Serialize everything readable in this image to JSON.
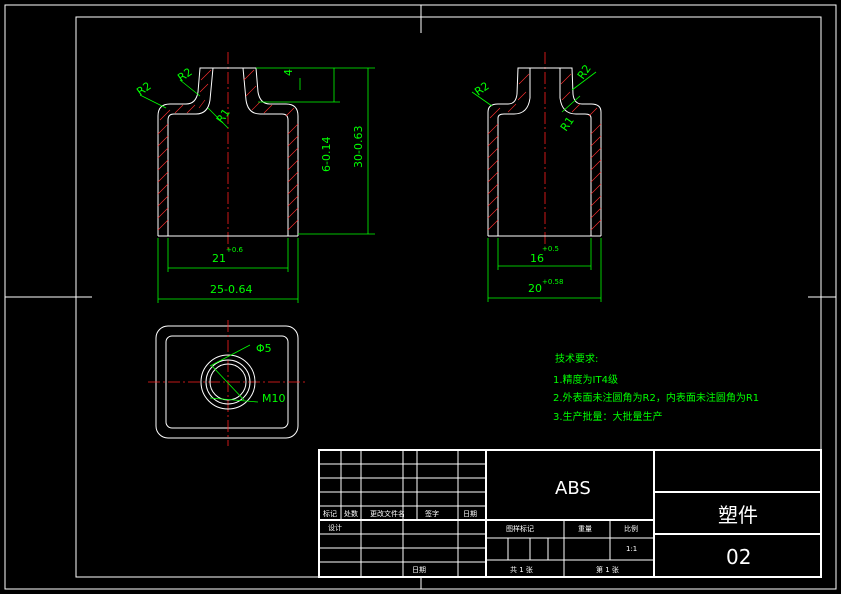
{
  "views": {
    "front_left": {
      "dim_top_depth": "4",
      "dim_inner_height": "6-0.14",
      "dim_total_height": "30-0.63",
      "dim_inner_width": "21",
      "dim_inner_width_tol": "+0.6",
      "dim_outer_width": "25-0.64",
      "radius_outer": "R2",
      "radius_outer2": "R2",
      "radius_inner": "R1"
    },
    "front_right": {
      "radius_a": "R2",
      "radius_b": "R2",
      "radius_c": "R1",
      "dim_inner_width": "16",
      "dim_inner_width_tol": "+0.5",
      "dim_outer_width": "20",
      "dim_outer_width_tol": "+0.58"
    },
    "top_view": {
      "dia_label": "Φ5",
      "thread_label": "M10"
    }
  },
  "tech_notes": {
    "title": "技术要求:",
    "items": [
      "1.精度为IT4级",
      "2.外表面未注圆角为R2，内表面未注圆角为R1",
      "3.生产批量：大批量生产"
    ]
  },
  "title_block": {
    "material": "ABS",
    "part_name": "塑件",
    "drawing_no": "02",
    "rev_headers": [
      "标记",
      "处数",
      "更改文件名",
      "签字",
      "日期"
    ],
    "row_design": "设计",
    "row_date": "日期",
    "stage_headers": [
      "图样标记",
      "重量",
      "比例"
    ],
    "scale": "1:1",
    "sheets_total": "共 1 张",
    "sheet_no": "第 1 张"
  }
}
